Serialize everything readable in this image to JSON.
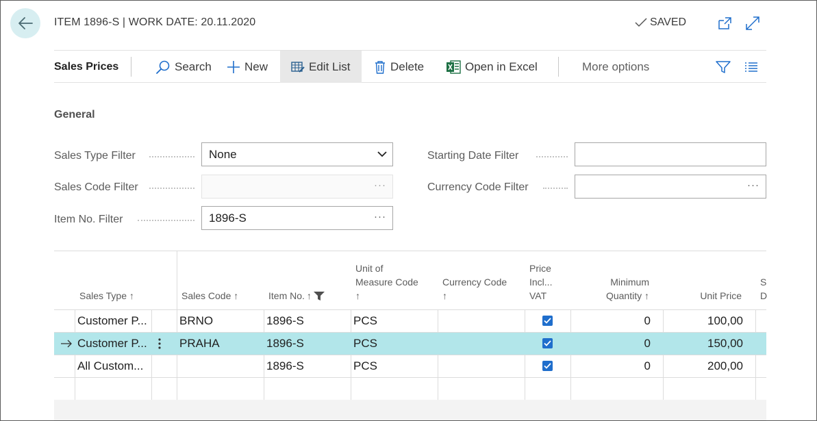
{
  "header": {
    "title": "ITEM 1896-S | WORK DATE: 20.11.2020",
    "saved_label": "SAVED"
  },
  "actions": {
    "page_label": "Sales Prices",
    "search": "Search",
    "new": "New",
    "edit_list": "Edit List",
    "delete": "Delete",
    "open_excel": "Open in Excel",
    "more_options": "More options"
  },
  "general": {
    "section_title": "General",
    "sales_type_filter": {
      "label": "Sales Type Filter",
      "value": "None"
    },
    "sales_code_filter": {
      "label": "Sales Code Filter",
      "value": ""
    },
    "item_no_filter": {
      "label": "Item No. Filter",
      "value": "1896-S"
    },
    "starting_date_filter": {
      "label": "Starting Date Filter",
      "value": ""
    },
    "currency_code_filter": {
      "label": "Currency Code Filter",
      "value": ""
    }
  },
  "grid": {
    "columns": {
      "sales_type": "Sales Type",
      "sales_code": "Sales Code",
      "item_no": "Item No.",
      "uom_line1": "Unit of",
      "uom_line2": "Measure Code",
      "currency_code": "Currency Code",
      "price_incl_line1": "Price",
      "price_incl_line2": "Incl...",
      "price_incl_line3": "VAT",
      "min_qty_line1": "Minimum",
      "min_qty_line2": "Quantity",
      "unit_price": "Unit Price",
      "cut_line1": "S",
      "cut_line2": "D"
    },
    "rows": [
      {
        "sales_type": "Customer P...",
        "sales_code": "BRNO",
        "item_no": "1896-S",
        "uom": "PCS",
        "currency": "",
        "price_incl_vat": true,
        "min_qty": "0",
        "unit_price": "100,00",
        "selected": false
      },
      {
        "sales_type": "Customer P...",
        "sales_code": "PRAHA",
        "item_no": "1896-S",
        "uom": "PCS",
        "currency": "",
        "price_incl_vat": true,
        "min_qty": "0",
        "unit_price": "150,00",
        "selected": true
      },
      {
        "sales_type": "All Custom...",
        "sales_code": "",
        "item_no": "1896-S",
        "uom": "PCS",
        "currency": "",
        "price_incl_vat": true,
        "min_qty": "0",
        "unit_price": "200,00",
        "selected": false
      }
    ]
  }
}
